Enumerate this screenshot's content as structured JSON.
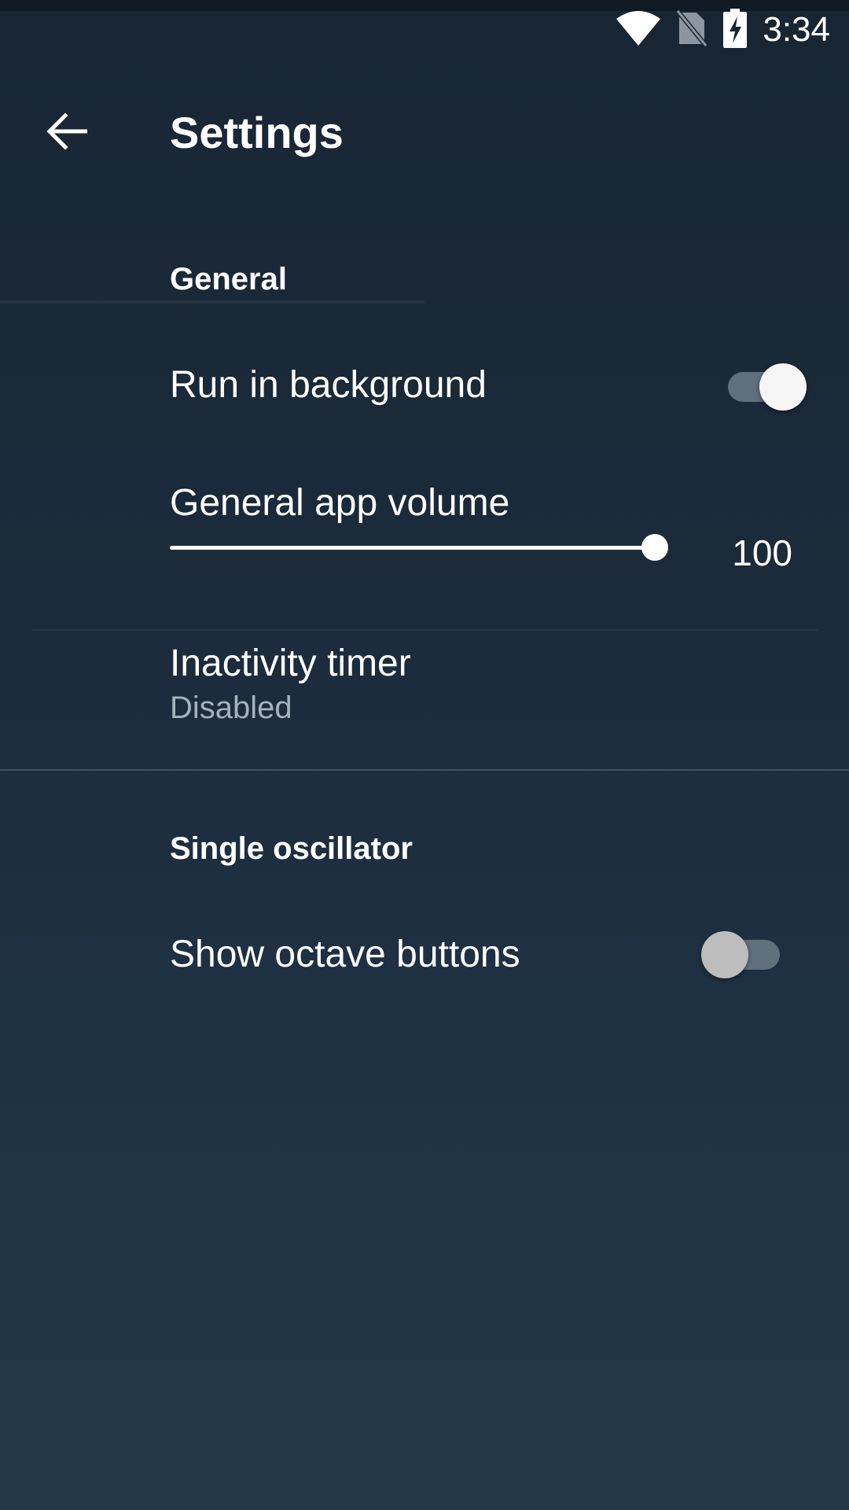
{
  "status_bar": {
    "time": "3:34",
    "icons": [
      "wifi-icon",
      "no-sim-icon",
      "battery-charging-icon"
    ]
  },
  "app_bar": {
    "title": "Settings",
    "back_icon": "arrow-back-icon"
  },
  "sections": {
    "general": {
      "header": "General",
      "run_in_background": {
        "title": "Run in background",
        "enabled": true
      },
      "volume": {
        "title": "General app volume",
        "value": "100",
        "fraction": 1.0
      },
      "inactivity": {
        "title": "Inactivity timer",
        "summary": "Disabled"
      }
    },
    "single_oscillator": {
      "header": "Single oscillator",
      "show_octave_buttons": {
        "title": "Show octave buttons",
        "enabled": false
      }
    }
  },
  "colors": {
    "background_top": "#182634",
    "background_bottom": "#21394b",
    "switch_track": "#5f6f7c",
    "summary_text": "#a6b2bd",
    "divider": "#3c5162"
  }
}
